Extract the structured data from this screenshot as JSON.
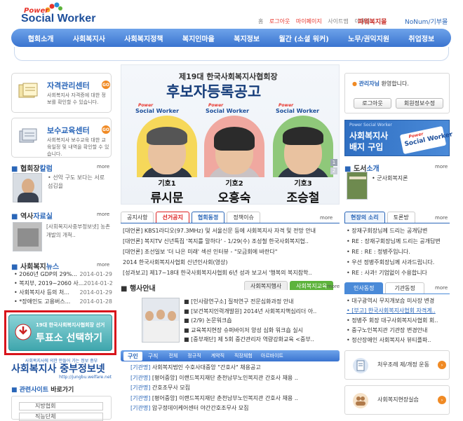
{
  "header": {
    "logo_power": "Power",
    "logo_main": "Social Worker",
    "top_links": [
      "홈",
      "로그아웃",
      "마이페이지",
      "사이트맵",
      "이메일"
    ],
    "partner1": "파워복지몰",
    "partner2": "NoNum/기부몰"
  },
  "nav": {
    "items": [
      "협회소개",
      "사회복지사",
      "사회복지정책",
      "복지인마을",
      "복지정보",
      "월간 (소셜 워커)",
      "노무/권익지원",
      "취업정보"
    ]
  },
  "left": {
    "cert": {
      "title": "자격관리센터",
      "desc": "사회복지사 자격증에 대한 정보를 확인할 수 있습니다.",
      "go": "GO"
    },
    "edu": {
      "title": "보수교육센터",
      "desc": "사회복지사 보수교육 대한 교육일정 및 내역을 확인할 수 있습니다.",
      "go": "GO"
    },
    "column": {
      "title_a": "협회장",
      "title_b": "칼럼",
      "more": "more",
      "text": "선악 구도 보다는 서로 섬김을"
    },
    "history": {
      "title_a": "역사",
      "title_b": "자료실",
      "more": "more",
      "text": "[사회복지사중부정보넷] 농촌개발의 개척.."
    },
    "news": {
      "title_a": "사회복지",
      "title_b": "뉴스",
      "more": "more",
      "items": [
        {
          "text": "2060년 GDP의 29%...",
          "date": "2014-01-29"
        },
        {
          "text": "복지부, 2019~2060 사...",
          "date": "2014-01-29"
        },
        {
          "text": "사회복지사 등의 처...",
          "date": "2014-01-29"
        },
        {
          "text": "*장애인도 고용버스...",
          "date": "2014-01-28"
        }
      ]
    },
    "vote": {
      "line1": "19대 한국사회복지사협회장 선거",
      "line2": "투표소 선택하기"
    },
    "jobnet": {
      "small": "사회복지사에 의한 만들어 가는 정보 중부",
      "title": "사회복지사 중부정보넷",
      "url": "http://jungbu.welfare.net"
    },
    "related": {
      "title_a": "관련사이트",
      "title_b": "바로가기",
      "select1": "지방협회",
      "select2": "직능단체"
    }
  },
  "banner": {
    "subtitle": "제19대 한국사회복지사협회장",
    "title": "후보자등록공고",
    "candidates": [
      {
        "num": "기호1",
        "name": "류시문"
      },
      {
        "num": "기호2",
        "name": "오흥숙"
      },
      {
        "num": "기호3",
        "name": "조승철"
      }
    ],
    "pager": [
      "1",
      "2"
    ],
    "brand": "Social Worker",
    "brand_small": "Power"
  },
  "center": {
    "tabs": [
      "공지사항",
      "선거공지",
      "협회동정",
      "정책이슈"
    ],
    "more": "more",
    "items": [
      "[대언론] KBS1라디오(97.3MHz) 및 서울신문 등에 사회복지사 자격 및 전망 안내",
      "[대언론] 복지TV 신년특집 '복지를 말하다' - 1/29(수) 조성철 한국사회복지협..",
      "[대언론] 조선일보 '더 나은 미래' 섹션 인터뷰 - \"모금회에 바란다\"",
      "2014 한국사회복지사협회 신년인사회(영상)",
      "[성과보고] 제17~18대 한국사회복지사협회 6년 성과 보고서 '행복의 복지참학.."
    ],
    "events": {
      "title": "행사안내",
      "tabs": [
        "사회복지행사",
        "사회복지교육"
      ],
      "more": "more",
      "items": [
        "[인사랑연구소] 질적연구 전문심화과정 안내",
        "[보건복지인력개발원] 2014년 사회복지핵심리더 아..",
        "(2/9) 논문워크숍",
        "교육복지현장 슈퍼바이저 양성 심화 워크숍 실시",
        "[중부재단] 제 5회 중간관리자 역량강화교육 <중부.."
      ]
    },
    "jobs": {
      "tabs": [
        "구인",
        "구직",
        "전체",
        "정규직",
        "계약직",
        "직장체험",
        "아르바이트"
      ],
      "items": [
        {
          "tag": "[기관명]",
          "text": "사회복지법인 수호사대중앙 \"간호사\" 채용공고"
        },
        {
          "tag": "[기관명]",
          "text": "[평어중앙] 이랜드복지재단 춘천남부노인복지관 간호사 채용 .."
        },
        {
          "tag": "[기관명]",
          "text": "간호조무사 모집"
        },
        {
          "tag": "[기관명]",
          "text": "[평어중앙] 이랜드복지재단 춘천남부노인복지관 간호사 채용 .."
        },
        {
          "tag": "[기관명]",
          "text": "압구정데이케어센터 야간간호조무사 모집"
        }
      ]
    }
  },
  "right": {
    "login": {
      "user": "관리자님",
      "welcome": "환영합니다.",
      "logout": "로그아웃",
      "edit": "회원정보수정"
    },
    "badge": {
      "small": "Power Social Worker",
      "title1": "사회복지사",
      "title2": "배지 구입",
      "brand_power": "Power",
      "brand_main": "Social Worker"
    },
    "books": {
      "title_a": "도서",
      "title_b": "소개",
      "more": "more",
      "item": "군사회복지론"
    },
    "voice": {
      "tabs": [
        "현장의 소리",
        "토론방"
      ],
      "more": "more",
      "items": [
        "장재구회장님께 드리는 공개답변",
        "RE : 장재구회장님께 드리는 공개답변",
        "RE : RE : 정병주입니다.",
        "우선 정병주회장님께 사과드립니다.",
        "RE : 사과! 기업없이 수용합니다"
      ]
    },
    "hr": {
      "tabs": [
        "인사동정",
        "기관동정"
      ],
      "more": "more",
      "items": [
        "대구광역시 무지개보습 미사장 변경",
        "[부고] 한국사회복지사협회 자격계..",
        "정병주 회장 대구사회복지사협회 회..",
        "중구노인복지관 기관장 변경안내",
        "정산장애인 사회복지사 뷰티플파.."
      ]
    },
    "links": {
      "counsel": "처우조례 제/개정 운동",
      "practice": "사회복지현장실습"
    }
  }
}
